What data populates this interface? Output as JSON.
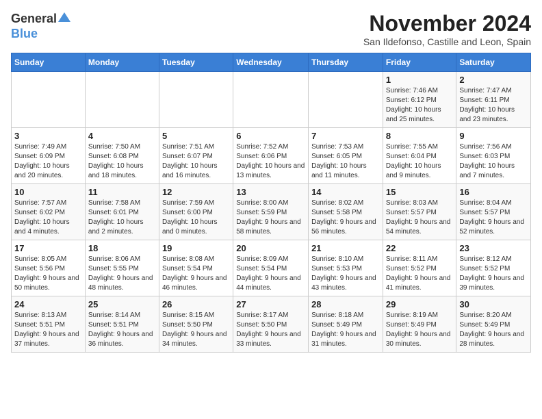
{
  "logo": {
    "general": "General",
    "blue": "Blue"
  },
  "title": "November 2024",
  "subtitle": "San Ildefonso, Castille and Leon, Spain",
  "days_of_week": [
    "Sunday",
    "Monday",
    "Tuesday",
    "Wednesday",
    "Thursday",
    "Friday",
    "Saturday"
  ],
  "weeks": [
    [
      {
        "day": "",
        "info": ""
      },
      {
        "day": "",
        "info": ""
      },
      {
        "day": "",
        "info": ""
      },
      {
        "day": "",
        "info": ""
      },
      {
        "day": "",
        "info": ""
      },
      {
        "day": "1",
        "info": "Sunrise: 7:46 AM\nSunset: 6:12 PM\nDaylight: 10 hours and 25 minutes."
      },
      {
        "day": "2",
        "info": "Sunrise: 7:47 AM\nSunset: 6:11 PM\nDaylight: 10 hours and 23 minutes."
      }
    ],
    [
      {
        "day": "3",
        "info": "Sunrise: 7:49 AM\nSunset: 6:09 PM\nDaylight: 10 hours and 20 minutes."
      },
      {
        "day": "4",
        "info": "Sunrise: 7:50 AM\nSunset: 6:08 PM\nDaylight: 10 hours and 18 minutes."
      },
      {
        "day": "5",
        "info": "Sunrise: 7:51 AM\nSunset: 6:07 PM\nDaylight: 10 hours and 16 minutes."
      },
      {
        "day": "6",
        "info": "Sunrise: 7:52 AM\nSunset: 6:06 PM\nDaylight: 10 hours and 13 minutes."
      },
      {
        "day": "7",
        "info": "Sunrise: 7:53 AM\nSunset: 6:05 PM\nDaylight: 10 hours and 11 minutes."
      },
      {
        "day": "8",
        "info": "Sunrise: 7:55 AM\nSunset: 6:04 PM\nDaylight: 10 hours and 9 minutes."
      },
      {
        "day": "9",
        "info": "Sunrise: 7:56 AM\nSunset: 6:03 PM\nDaylight: 10 hours and 7 minutes."
      }
    ],
    [
      {
        "day": "10",
        "info": "Sunrise: 7:57 AM\nSunset: 6:02 PM\nDaylight: 10 hours and 4 minutes."
      },
      {
        "day": "11",
        "info": "Sunrise: 7:58 AM\nSunset: 6:01 PM\nDaylight: 10 hours and 2 minutes."
      },
      {
        "day": "12",
        "info": "Sunrise: 7:59 AM\nSunset: 6:00 PM\nDaylight: 10 hours and 0 minutes."
      },
      {
        "day": "13",
        "info": "Sunrise: 8:00 AM\nSunset: 5:59 PM\nDaylight: 9 hours and 58 minutes."
      },
      {
        "day": "14",
        "info": "Sunrise: 8:02 AM\nSunset: 5:58 PM\nDaylight: 9 hours and 56 minutes."
      },
      {
        "day": "15",
        "info": "Sunrise: 8:03 AM\nSunset: 5:57 PM\nDaylight: 9 hours and 54 minutes."
      },
      {
        "day": "16",
        "info": "Sunrise: 8:04 AM\nSunset: 5:57 PM\nDaylight: 9 hours and 52 minutes."
      }
    ],
    [
      {
        "day": "17",
        "info": "Sunrise: 8:05 AM\nSunset: 5:56 PM\nDaylight: 9 hours and 50 minutes."
      },
      {
        "day": "18",
        "info": "Sunrise: 8:06 AM\nSunset: 5:55 PM\nDaylight: 9 hours and 48 minutes."
      },
      {
        "day": "19",
        "info": "Sunrise: 8:08 AM\nSunset: 5:54 PM\nDaylight: 9 hours and 46 minutes."
      },
      {
        "day": "20",
        "info": "Sunrise: 8:09 AM\nSunset: 5:54 PM\nDaylight: 9 hours and 44 minutes."
      },
      {
        "day": "21",
        "info": "Sunrise: 8:10 AM\nSunset: 5:53 PM\nDaylight: 9 hours and 43 minutes."
      },
      {
        "day": "22",
        "info": "Sunrise: 8:11 AM\nSunset: 5:52 PM\nDaylight: 9 hours and 41 minutes."
      },
      {
        "day": "23",
        "info": "Sunrise: 8:12 AM\nSunset: 5:52 PM\nDaylight: 9 hours and 39 minutes."
      }
    ],
    [
      {
        "day": "24",
        "info": "Sunrise: 8:13 AM\nSunset: 5:51 PM\nDaylight: 9 hours and 37 minutes."
      },
      {
        "day": "25",
        "info": "Sunrise: 8:14 AM\nSunset: 5:51 PM\nDaylight: 9 hours and 36 minutes."
      },
      {
        "day": "26",
        "info": "Sunrise: 8:15 AM\nSunset: 5:50 PM\nDaylight: 9 hours and 34 minutes."
      },
      {
        "day": "27",
        "info": "Sunrise: 8:17 AM\nSunset: 5:50 PM\nDaylight: 9 hours and 33 minutes."
      },
      {
        "day": "28",
        "info": "Sunrise: 8:18 AM\nSunset: 5:49 PM\nDaylight: 9 hours and 31 minutes."
      },
      {
        "day": "29",
        "info": "Sunrise: 8:19 AM\nSunset: 5:49 PM\nDaylight: 9 hours and 30 minutes."
      },
      {
        "day": "30",
        "info": "Sunrise: 8:20 AM\nSunset: 5:49 PM\nDaylight: 9 hours and 28 minutes."
      }
    ]
  ]
}
